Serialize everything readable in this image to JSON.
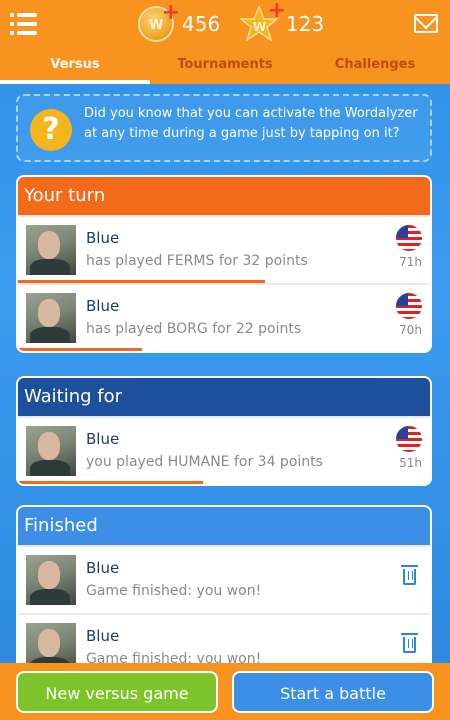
{
  "header": {
    "coins": "456",
    "stars": "123",
    "coin_letter": "W",
    "star_letter": "W",
    "icons": [
      "menu-icon",
      "coin-icon",
      "star-icon",
      "mail-icon"
    ]
  },
  "tabs": [
    {
      "label": "Versus",
      "active": true
    },
    {
      "label": "Tournaments",
      "active": false
    },
    {
      "label": "Challenges",
      "active": false
    }
  ],
  "tip": {
    "icon": "?",
    "text": "Did you know that you can activate the Wordalyzer at any time during a game just by tapping on it?"
  },
  "sections": {
    "your_turn": {
      "title": "Your turn",
      "color": "#f26a1a",
      "rows": [
        {
          "name": "Blue",
          "desc": "has played FERMS for 32 points",
          "time": "71h",
          "progress": 0.6
        },
        {
          "name": "Blue",
          "desc": "has played BORG for 22 points",
          "time": "70h",
          "progress": 0.3
        }
      ]
    },
    "waiting": {
      "title": "Waiting for",
      "color": "#1c4f9c",
      "rows": [
        {
          "name": "Blue",
          "desc": "you played HUMANE for 34 points",
          "time": "51h",
          "progress": 0.45
        }
      ]
    },
    "finished": {
      "title": "Finished",
      "color": "#3c8ee6",
      "rows": [
        {
          "name": "Blue",
          "desc": "Game finished: you won!"
        },
        {
          "name": "Blue",
          "desc": "Game finished: you won!"
        }
      ]
    }
  },
  "buttons": {
    "new_versus": "New versus game",
    "start_battle": "Start a battle"
  }
}
